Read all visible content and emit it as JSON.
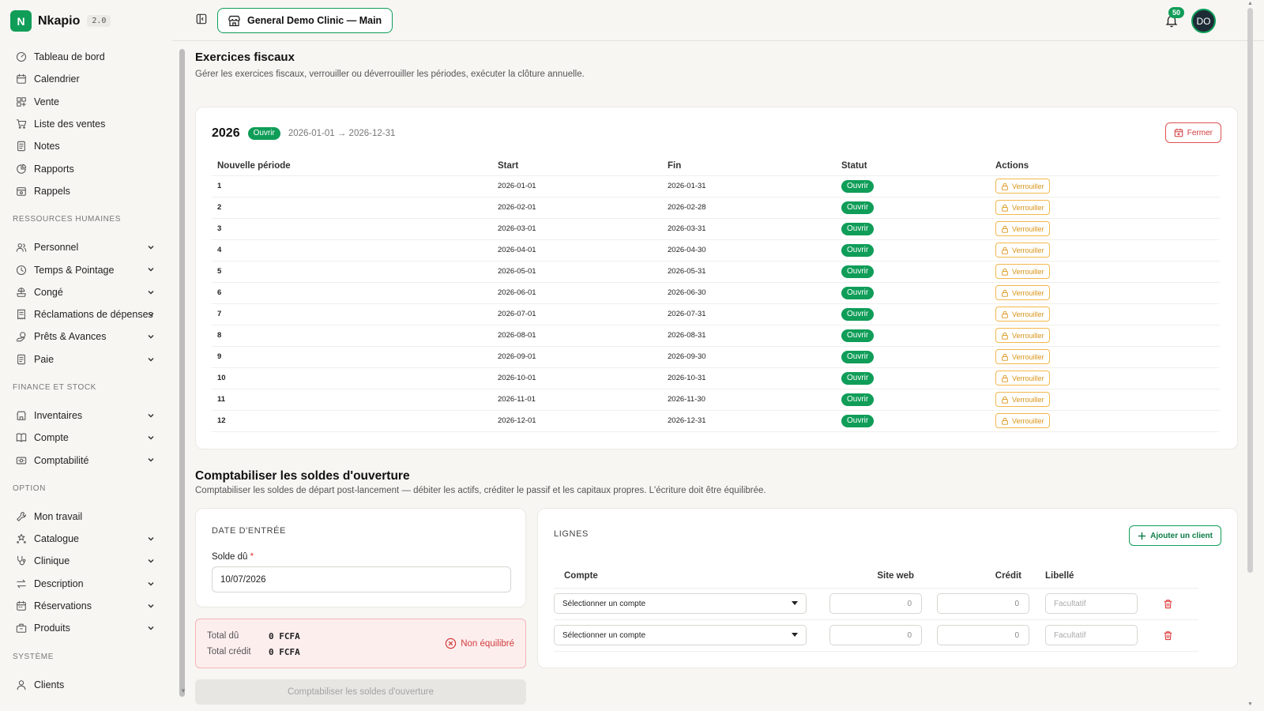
{
  "app": {
    "logo_letter": "N",
    "name": "Nkapio",
    "version": "2.0"
  },
  "sidebar": {
    "group_main": [
      {
        "icon": "dashboard-icon",
        "label": "Tableau de bord"
      },
      {
        "icon": "calendar-icon",
        "label": "Calendrier"
      },
      {
        "icon": "grid-icon",
        "label": "Vente"
      },
      {
        "icon": "cart-icon",
        "label": "Liste des ventes"
      },
      {
        "icon": "notes-icon",
        "label": "Notes"
      },
      {
        "icon": "reports-icon",
        "label": "Rapports"
      },
      {
        "icon": "reminder-icon",
        "label": "Rappels"
      }
    ],
    "section_hr": "RESSOURCES HUMAINES",
    "group_hr": [
      {
        "icon": "users-icon",
        "label": "Personnel"
      },
      {
        "icon": "clock-icon",
        "label": "Temps & Pointage"
      },
      {
        "icon": "leave-icon",
        "label": "Congé"
      },
      {
        "icon": "receipt-icon",
        "label": "Réclamations de dépenses"
      },
      {
        "icon": "loan-icon",
        "label": "Prêts & Avances"
      },
      {
        "icon": "payroll-icon",
        "label": "Paie"
      }
    ],
    "section_finance": "FINANCE ET STOCK",
    "group_finance": [
      {
        "icon": "inventory-icon",
        "label": "Inventaires"
      },
      {
        "icon": "book-icon",
        "label": "Compte"
      },
      {
        "icon": "accounting-icon",
        "label": "Comptabilité"
      }
    ],
    "section_option": "OPTION",
    "group_option": [
      {
        "icon": "wrench-icon",
        "label": "Mon travail"
      },
      {
        "icon": "catalog-icon",
        "label": "Catalogue"
      },
      {
        "icon": "stethoscope-icon",
        "label": "Clinique"
      },
      {
        "icon": "swap-icon",
        "label": "Description"
      },
      {
        "icon": "bookings-icon",
        "label": "Réservations"
      },
      {
        "icon": "products-icon",
        "label": "Produits"
      }
    ],
    "section_system": "SYSTÈME",
    "group_system": [
      {
        "icon": "user-icon",
        "label": "Clients"
      }
    ]
  },
  "topbar": {
    "clinic": "General Demo Clinic — Main",
    "notifications": "50",
    "avatar_initials": "DO"
  },
  "fiscal": {
    "title": "Exercices fiscaux",
    "subtitle": "Gérer les exercices fiscaux, verrouiller ou déverrouiller les périodes, exécuter la clôture annuelle.",
    "year": "2026",
    "year_status": "Ouvrir",
    "range": "2026-01-01 → 2026-12-31",
    "close_label": "Fermer",
    "columns": [
      "Nouvelle période",
      "Start",
      "Fin",
      "Statut",
      "Actions"
    ],
    "status_label": "Ouvrir",
    "lock_label": "Verrouiller",
    "periods": [
      {
        "n": "1",
        "start": "2026-01-01",
        "end": "2026-01-31"
      },
      {
        "n": "2",
        "start": "2026-02-01",
        "end": "2026-02-28"
      },
      {
        "n": "3",
        "start": "2026-03-01",
        "end": "2026-03-31"
      },
      {
        "n": "4",
        "start": "2026-04-01",
        "end": "2026-04-30"
      },
      {
        "n": "5",
        "start": "2026-05-01",
        "end": "2026-05-31"
      },
      {
        "n": "6",
        "start": "2026-06-01",
        "end": "2026-06-30"
      },
      {
        "n": "7",
        "start": "2026-07-01",
        "end": "2026-07-31"
      },
      {
        "n": "8",
        "start": "2026-08-01",
        "end": "2026-08-31"
      },
      {
        "n": "9",
        "start": "2026-09-01",
        "end": "2026-09-30"
      },
      {
        "n": "10",
        "start": "2026-10-01",
        "end": "2026-10-31"
      },
      {
        "n": "11",
        "start": "2026-11-01",
        "end": "2026-11-30"
      },
      {
        "n": "12",
        "start": "2026-12-01",
        "end": "2026-12-31"
      }
    ]
  },
  "opening": {
    "title": "Comptabiliser les soldes d'ouverture",
    "subtitle": "Comptabiliser les soldes de départ post-lancement — débiter les actifs, créditer le passif et les capitaux propres. L'écriture doit être équilibrée.",
    "entry_section": "DATE D'ENTRÉE",
    "date_label": "Solde dû",
    "date_required": "*",
    "date_value": "10/07/2026",
    "total_debit_label": "Total dû",
    "total_debit_value": "0 FCFA",
    "total_credit_label": "Total crédit",
    "total_credit_value": "0 FCFA",
    "balance_status": "Non équilibré",
    "submit_label": "Comptabiliser les soldes d'ouverture",
    "lines_section": "LIGNES",
    "add_label": "Ajouter un client",
    "line_columns": [
      "Compte",
      "Site web",
      "Crédit",
      "Libellé"
    ],
    "lines": [
      {
        "account": "Sélectionner un compte",
        "debit": "0",
        "credit": "0",
        "label_placeholder": "Facultatif"
      },
      {
        "account": "Sélectionner un compte",
        "debit": "0",
        "credit": "0",
        "label_placeholder": "Facultatif"
      }
    ]
  },
  "colors": {
    "accent": "#0f9d58",
    "warning": "#f2b84b",
    "danger": "#e03b3b"
  }
}
